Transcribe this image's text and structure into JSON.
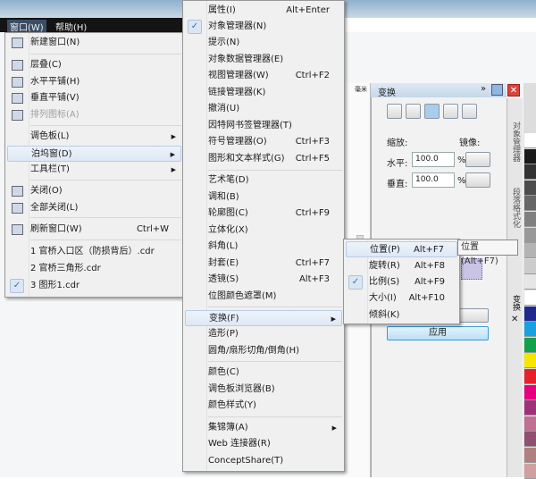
{
  "menubar": {
    "window": "窗口(W)",
    "help": "帮助(H)"
  },
  "window_menu": [
    {
      "label": "新建窗口(N)",
      "icon": "new-window-icon"
    },
    {
      "label": "层叠(C)",
      "icon": "cascade-icon"
    },
    {
      "label": "水平平铺(H)",
      "icon": "tile-horizontal-icon"
    },
    {
      "label": "垂直平铺(V)",
      "icon": "tile-vertical-icon"
    },
    {
      "label": "排列图标(A)",
      "icon": "arrange-icons-icon",
      "disabled": true
    },
    {
      "label": "调色板(L)",
      "submenu": true
    },
    {
      "label": "泊坞窗(D)",
      "submenu": true,
      "highlighted": true
    },
    {
      "label": "工具栏(T)",
      "submenu": true
    },
    {
      "label": "关闭(O)",
      "icon": "close-window-icon"
    },
    {
      "label": "全部关闭(L)",
      "icon": "close-all-icon"
    },
    {
      "label": "刷新窗口(W)",
      "shortcut": "Ctrl+W",
      "icon": "refresh-window-icon"
    },
    {
      "label": "1 官桥入口区（防损背后）.cdr"
    },
    {
      "label": "2 官桥三角形.cdr"
    },
    {
      "label": "3 图形1.cdr",
      "checked": true
    }
  ],
  "dockers_menu": [
    {
      "label": "属性(I)",
      "shortcut": "Alt+Enter"
    },
    {
      "label": "对象管理器(N)",
      "checked": true
    },
    {
      "label": "提示(N)"
    },
    {
      "label": "对象数据管理器(E)"
    },
    {
      "label": "视图管理器(W)",
      "shortcut": "Ctrl+F2"
    },
    {
      "label": "链接管理器(K)"
    },
    {
      "label": "撤消(U)"
    },
    {
      "label": "因特网书签管理器(T)"
    },
    {
      "label": "符号管理器(O)",
      "shortcut": "Ctrl+F3"
    },
    {
      "label": "图形和文本样式(G)",
      "shortcut": "Ctrl+F5"
    },
    {
      "label": "艺术笔(D)"
    },
    {
      "label": "调和(B)"
    },
    {
      "label": "轮廓图(C)",
      "shortcut": "Ctrl+F9"
    },
    {
      "label": "立体化(X)"
    },
    {
      "label": "斜角(L)"
    },
    {
      "label": "封套(E)",
      "shortcut": "Ctrl+F7"
    },
    {
      "label": "透镜(S)",
      "shortcut": "Alt+F3"
    },
    {
      "label": "位图颜色遮罩(M)"
    },
    {
      "label": "变换(F)",
      "submenu": true,
      "highlighted": true
    },
    {
      "label": "造形(P)"
    },
    {
      "label": "圆角/扇形切角/倒角(H)"
    },
    {
      "label": "颜色(C)"
    },
    {
      "label": "调色板浏览器(B)"
    },
    {
      "label": "颜色样式(Y)"
    },
    {
      "label": "集锦簿(A)",
      "submenu": true
    },
    {
      "label": "Web 连接器(R)"
    },
    {
      "label": "ConceptShare(T)"
    }
  ],
  "transform_menu": [
    {
      "label": "位置(P)",
      "shortcut": "Alt+F7",
      "highlighted": true
    },
    {
      "label": "旋转(R)",
      "shortcut": "Alt+F8"
    },
    {
      "label": "比例(S)",
      "shortcut": "Alt+F9",
      "checked": true
    },
    {
      "label": "大小(I)",
      "shortcut": "Alt+F10"
    },
    {
      "label": "倾斜(K)"
    }
  ],
  "tooltip": "位置 (Alt+F7)",
  "panel": {
    "title": "变换",
    "scale_label": "缩放:",
    "mirror_label": "镜像:",
    "h_label": "水平:",
    "v_label": "垂直:",
    "h_value": "100.0",
    "v_value": "100.0",
    "percent": "%",
    "apply": "应用",
    "ruler_unit": "毫米"
  },
  "vtabs": [
    "对象管理器",
    "段落格式化",
    "变换"
  ],
  "palette": [
    "#ffffff",
    "#1a1a1a",
    "#333333",
    "#4d4d4d",
    "#666666",
    "#808080",
    "#999999",
    "#b3b3b3",
    "#cccccc",
    "#e6e6e6",
    "#ffffff",
    "#1f2a8c",
    "#1a9fe0",
    "#12a04a",
    "#f5e600",
    "#e8202a",
    "#e6007e",
    "#a0307a",
    "#c07090",
    "#905070",
    "#b08080",
    "#d0a0a0"
  ]
}
